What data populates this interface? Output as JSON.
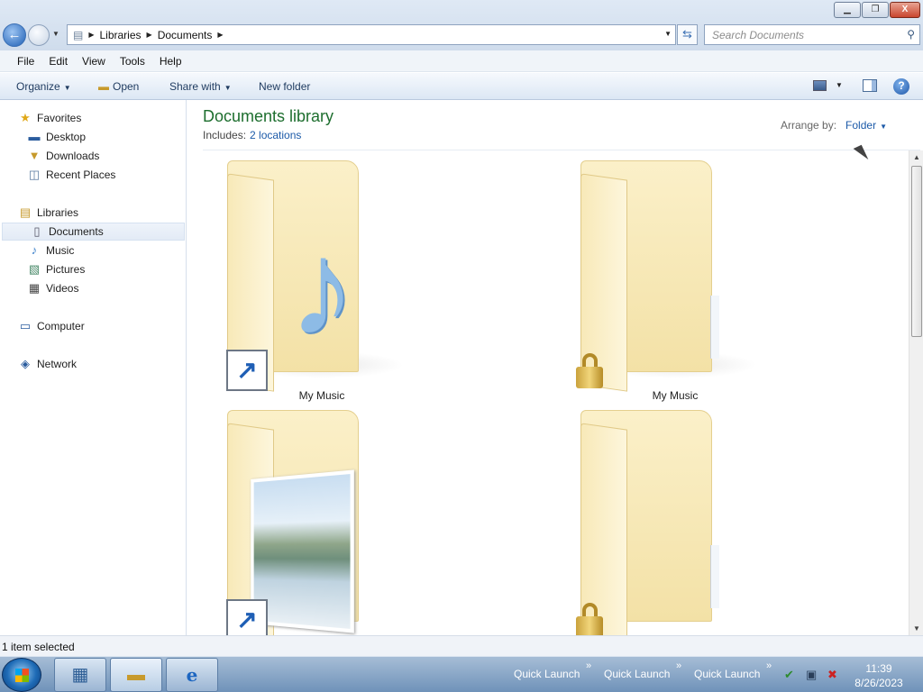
{
  "titlebar": {
    "min_icon": "minimize-icon",
    "max_icon": "maximize-icon",
    "close_icon": "close-icon",
    "min_glyph": "▁",
    "max_glyph": "❐",
    "close_glyph": "X"
  },
  "address": {
    "segments": [
      "Libraries",
      "Documents"
    ],
    "sep_glyph": "▶",
    "dropdown_glyph": "▼"
  },
  "search": {
    "placeholder": "Search Documents",
    "icon_glyph": "⚲"
  },
  "menu": {
    "items": [
      "File",
      "Edit",
      "View",
      "Tools",
      "Help"
    ]
  },
  "toolbar": {
    "organize": "Organize",
    "open": "Open",
    "share": "Share with",
    "new_folder": "New folder",
    "dd_glyph": "▼",
    "help_glyph": "?"
  },
  "nav": {
    "favorites": {
      "label": "Favorites",
      "icon": "star-icon",
      "glyph": "★"
    },
    "favorites_items": [
      {
        "label": "Desktop",
        "icon": "desktop-icon",
        "glyph": "▬"
      },
      {
        "label": "Downloads",
        "icon": "downloads-icon",
        "glyph": "▼"
      },
      {
        "label": "Recent Places",
        "icon": "recent-places-icon",
        "glyph": "◫"
      }
    ],
    "libraries": {
      "label": "Libraries",
      "icon": "libraries-icon",
      "glyph": "▤"
    },
    "libraries_items": [
      {
        "label": "Documents",
        "icon": "document-icon",
        "glyph": "▯"
      },
      {
        "label": "Music",
        "icon": "music-icon",
        "glyph": "♪"
      },
      {
        "label": "Pictures",
        "icon": "pictures-icon",
        "glyph": "▧"
      },
      {
        "label": "Videos",
        "icon": "videos-icon",
        "glyph": "▦"
      }
    ],
    "computer": {
      "label": "Computer",
      "icon": "computer-icon",
      "glyph": "▭"
    },
    "network": {
      "label": "Network",
      "icon": "network-icon",
      "glyph": "◈"
    }
  },
  "library": {
    "title": "Documents library",
    "includes_label": "Includes:",
    "includes_link": "2 locations",
    "arrange_label": "Arrange by:",
    "arrange_value": "Folder"
  },
  "tiles": [
    {
      "label": "My Music",
      "overlay": "shortcut-icon",
      "content": "music-note-icon"
    },
    {
      "label": "My Music",
      "overlay": "lock-icon",
      "content": ""
    },
    {
      "label": "",
      "overlay": "shortcut-icon",
      "content": "picture-icon"
    },
    {
      "label": "",
      "overlay": "lock-icon",
      "content": ""
    }
  ],
  "glyphs": {
    "note": "♪",
    "shortcut": "↗",
    "scroll_up": "▲",
    "scroll_down": "▼"
  },
  "status": {
    "text": "1 item selected"
  },
  "taskbar": {
    "quick_launch": [
      "Quick Launch",
      "Quick Launch",
      "Quick Launch"
    ],
    "chevron": "»",
    "time": "11:39",
    "date": "8/26/2023",
    "tray": [
      {
        "icon": "security-tray-icon",
        "glyph": "✔"
      },
      {
        "icon": "network-tray-icon",
        "glyph": "▣"
      },
      {
        "icon": "volume-muted-tray-icon",
        "glyph": "✖"
      }
    ],
    "buttons": [
      {
        "icon": "control-panel-icon",
        "glyph": "▦"
      },
      {
        "icon": "explorer-icon",
        "glyph": "▬"
      },
      {
        "icon": "internet-explorer-icon",
        "glyph": "e"
      }
    ]
  },
  "colors": {
    "accent": "#1d6e2e",
    "link": "#1c5aa8"
  }
}
